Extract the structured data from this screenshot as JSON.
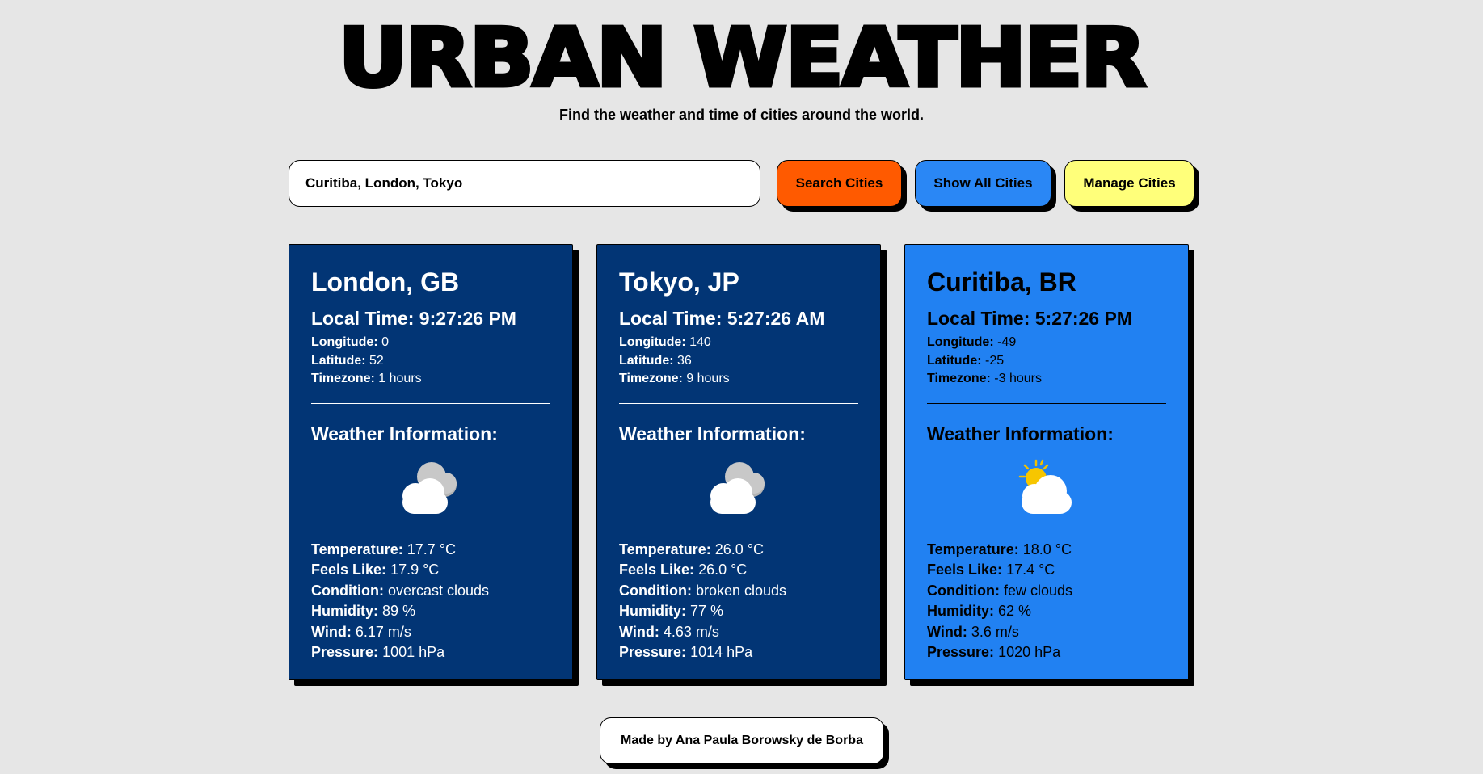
{
  "header": {
    "title": "URBAN WEATHER",
    "subtitle": "Find the weather and time of cities around the world."
  },
  "search": {
    "value": "Curitiba, London, Tokyo",
    "placeholder": ""
  },
  "buttons": {
    "search": "Search Cities",
    "show_all": "Show All Cities",
    "manage": "Manage Cities"
  },
  "labels": {
    "local_time": "Local Time:",
    "longitude": "Longitude:",
    "latitude": "Latitude:",
    "timezone": "Timezone:",
    "weather_info": "Weather Information:",
    "temperature": "Temperature:",
    "feels_like": "Feels Like:",
    "condition": "Condition:",
    "humidity": "Humidity:",
    "wind": "Wind:",
    "pressure": "Pressure:"
  },
  "cities": [
    {
      "name": "London, GB",
      "local_time": "9:27:26 PM",
      "longitude": "0",
      "latitude": "52",
      "timezone": "1 hours",
      "icon": "overcast-clouds-icon",
      "temperature": "17.7 °C",
      "feels_like": "17.9 °C",
      "condition": "overcast clouds",
      "humidity": "89 %",
      "wind": "6.17 m/s",
      "pressure": "1001 hPa"
    },
    {
      "name": "Tokyo, JP",
      "local_time": "5:27:26 AM",
      "longitude": "140",
      "latitude": "36",
      "timezone": "9 hours",
      "icon": "broken-clouds-icon",
      "temperature": "26.0 °C",
      "feels_like": "26.0 °C",
      "condition": "broken clouds",
      "humidity": "77 %",
      "wind": "4.63 m/s",
      "pressure": "1014 hPa"
    },
    {
      "name": "Curitiba, BR",
      "local_time": "5:27:26 PM",
      "longitude": "-49",
      "latitude": "-25",
      "timezone": "-3 hours",
      "icon": "few-clouds-icon",
      "temperature": "18.0 °C",
      "feels_like": "17.4 °C",
      "condition": "few clouds",
      "humidity": "62 %",
      "wind": "3.6 m/s",
      "pressure": "1020 hPa"
    }
  ],
  "footer": {
    "credit": "Made by Ana Paula Borowsky de Borba"
  },
  "colors": {
    "background": "#e6e6e6",
    "search_button": "#ff5a00",
    "show_all_button": "#2a87f5",
    "manage_button": "#ffff7a",
    "card_night": "#023575",
    "card_day": "#2181f2"
  }
}
